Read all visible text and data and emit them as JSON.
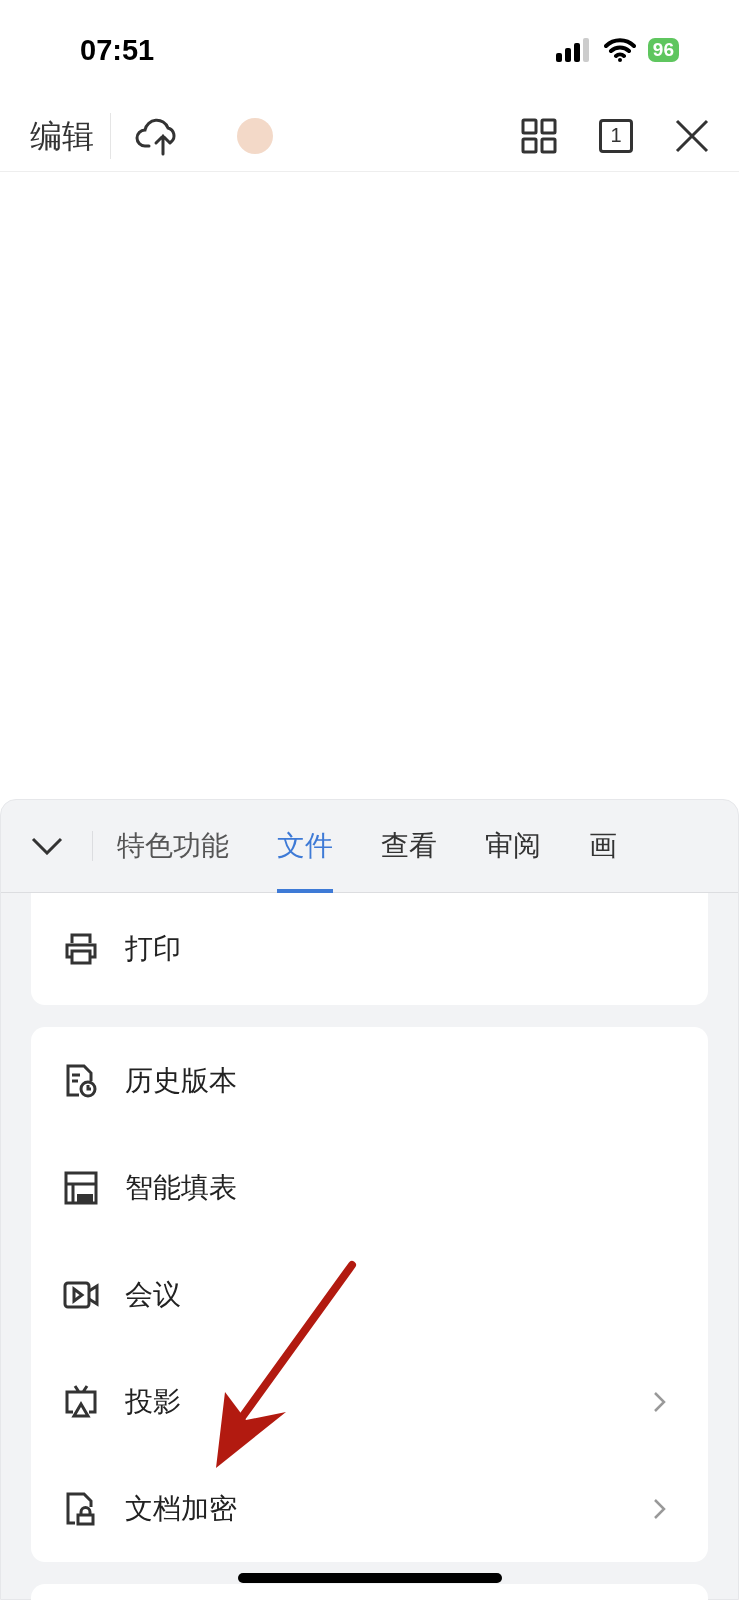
{
  "status_bar": {
    "time": "07:51",
    "battery": "96"
  },
  "toolbar": {
    "edit_label": "编辑",
    "page_count": "1"
  },
  "tabs": [
    {
      "label": "特色功能",
      "selected": false
    },
    {
      "label": "文件",
      "selected": true
    },
    {
      "label": "查看",
      "selected": false
    },
    {
      "label": "审阅",
      "selected": false
    },
    {
      "label": "画",
      "selected": false
    }
  ],
  "groups": [
    {
      "items": [
        {
          "label": "打印",
          "chevron": false
        }
      ]
    },
    {
      "items": [
        {
          "label": "历史版本",
          "chevron": false
        },
        {
          "label": "智能填表",
          "chevron": false
        },
        {
          "label": "会议",
          "chevron": false
        },
        {
          "label": "投影",
          "chevron": true
        },
        {
          "label": "文档加密",
          "chevron": true
        }
      ]
    }
  ]
}
